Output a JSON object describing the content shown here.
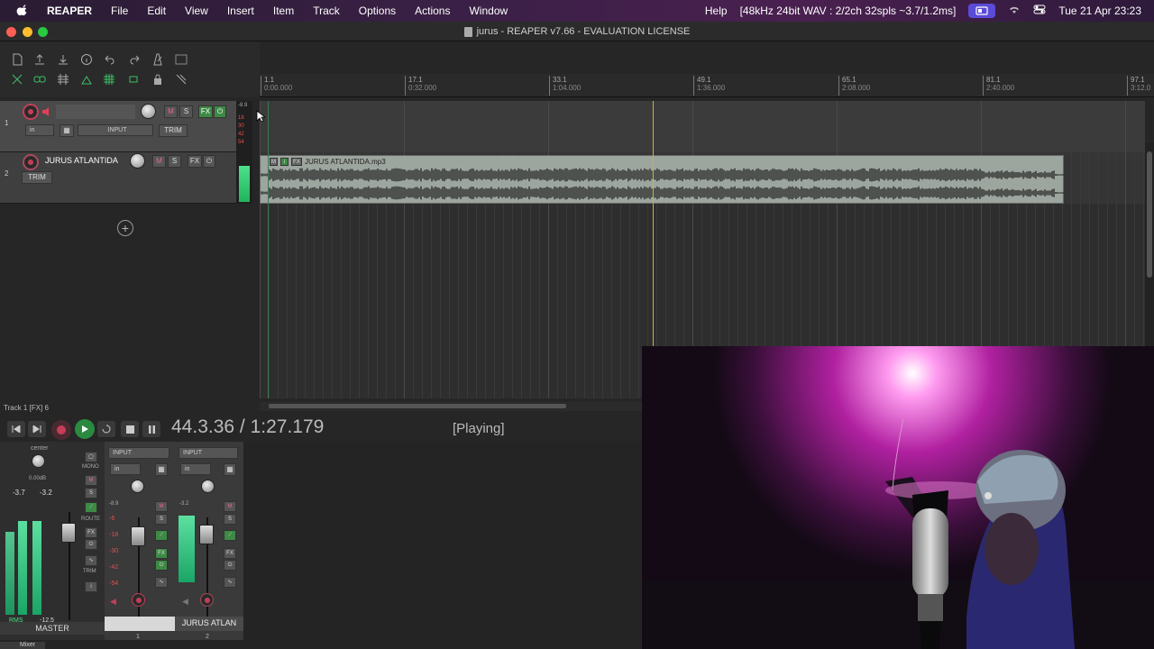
{
  "menubar": {
    "app": "REAPER",
    "items": [
      "File",
      "Edit",
      "View",
      "Insert",
      "Item",
      "Track",
      "Options",
      "Actions",
      "Window"
    ],
    "help": "Help",
    "audio_status": "[48kHz 24bit WAV : 2/2ch 32spls ~3.7/1.2ms]",
    "clock": "Tue 21 Apr  23:23"
  },
  "window": {
    "title": "jurus - REAPER v7.66 - EVALUATION LICENSE"
  },
  "ruler": [
    {
      "bar": "1.1",
      "time": "0:00.000"
    },
    {
      "bar": "17.1",
      "time": "0:32.000"
    },
    {
      "bar": "33.1",
      "time": "1:04.000"
    },
    {
      "bar": "49.1",
      "time": "1:36.000"
    },
    {
      "bar": "65.1",
      "time": "2:08.000"
    },
    {
      "bar": "81.1",
      "time": "2:40.000"
    },
    {
      "bar": "97.1",
      "time": "3:12.0"
    }
  ],
  "tracks": [
    {
      "number": "1",
      "name": "",
      "input": "INPUT",
      "in": "in",
      "trim": "TRIM",
      "fx": "FX",
      "mute": "M",
      "solo": "S"
    },
    {
      "number": "2",
      "name": "JURUS ATLANTIDA",
      "trim": "TRIM",
      "fx": "FX",
      "mute": "M",
      "solo": "S"
    }
  ],
  "meter_labels": [
    "-8.9",
    "18",
    "30",
    "42",
    "54"
  ],
  "media_item": {
    "name": "JURUS ATLANTIDA.mp3",
    "buttons": [
      "M",
      "i",
      "FX"
    ]
  },
  "status_line": "Track 1 [FX] 6",
  "transport": {
    "time": "44.3.36 / 1:27.179",
    "state": "[Playing]"
  },
  "mixer": {
    "master": {
      "pan": "center",
      "volume": "0.00dB",
      "peak_left": "-3.7",
      "peak_right": "-3.2",
      "rms_label": "RMS",
      "rms_value": "-12.5",
      "name": "MASTER",
      "buttons": [
        "MONO",
        "M",
        "S",
        "ROUTE",
        "FX",
        "TRIM"
      ]
    },
    "strips": [
      {
        "input": "INPUT",
        "in": "in",
        "level": "-8.9",
        "scale": [
          "-6",
          "-18",
          "-30",
          "-42",
          "-54"
        ],
        "name": "",
        "number": "1"
      },
      {
        "input": "INPUT",
        "in": "in",
        "level": "-3.2",
        "name": "JURUS ATLAN",
        "number": "2"
      }
    ],
    "tab": "Mixer"
  },
  "colors": {
    "accent_green": "#3d8a45",
    "rec_red": "#c43e58",
    "play_cursor": "#c6b341",
    "item_bg": "#9da59f"
  }
}
